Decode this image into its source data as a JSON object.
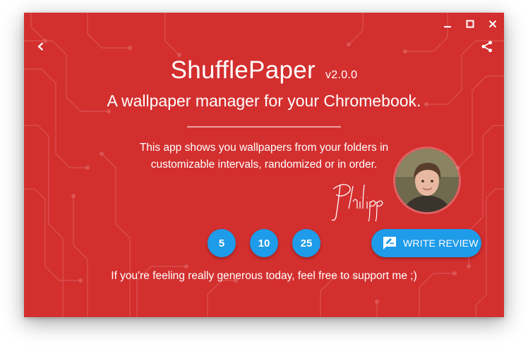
{
  "window": {
    "controls": [
      "minimize-icon",
      "maximize-icon",
      "close-icon"
    ]
  },
  "toolbar": {
    "back_icon": "back-arrow-icon",
    "share_icon": "share-icon"
  },
  "app": {
    "title": "ShufflePaper",
    "version": "v2.0.0",
    "subtitle": "A wallpaper manager for your Chromebook.",
    "description_line1": "This app shows you wallpapers from your folders in",
    "description_line2": "customizable intervals, randomized or in order.",
    "signature": "Philipp"
  },
  "donate": {
    "amounts": [
      "5",
      "10",
      "25"
    ]
  },
  "review": {
    "label": "WRITE REVIEW",
    "icon": "rate-review-icon"
  },
  "support_text": "If you're feeling really generous today, feel free to support me ;)",
  "colors": {
    "background": "#d32f2f",
    "accent": "#1e9be9",
    "text": "#ffffff"
  }
}
